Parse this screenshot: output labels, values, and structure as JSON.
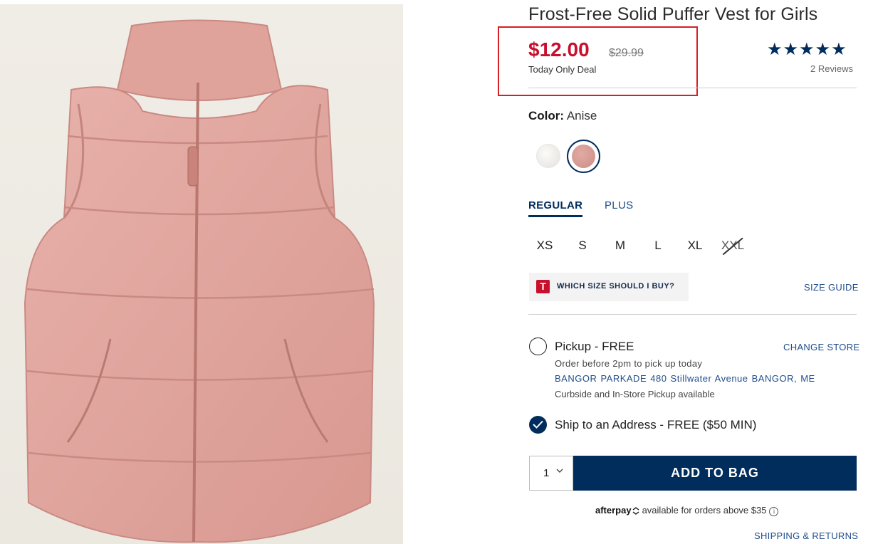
{
  "product": {
    "title": "Frost-Free Solid Puffer Vest for Girls",
    "image_alt": "pink puffer vest product photo"
  },
  "price": {
    "current": "$12.00",
    "original": "$29.99",
    "deal_label": "Today Only Deal",
    "highlight_color": "#d81f26"
  },
  "rating": {
    "stars": 5,
    "stars_glyph": "★★★★★",
    "reviews_label": "2 Reviews"
  },
  "color": {
    "label": "Color:",
    "selected": "Anise",
    "swatches": [
      {
        "name": "white",
        "hex": "#f2f1ee",
        "selected": false
      },
      {
        "name": "anise-pink",
        "hex": "#d49b95",
        "selected": true
      }
    ]
  },
  "fit": {
    "tabs": [
      "REGULAR",
      "PLUS"
    ],
    "active": "REGULAR"
  },
  "sizes": [
    {
      "label": "XS",
      "available": true
    },
    {
      "label": "S",
      "available": true
    },
    {
      "label": "M",
      "available": true
    },
    {
      "label": "L",
      "available": true
    },
    {
      "label": "XL",
      "available": true
    },
    {
      "label": "XXL",
      "available": false
    }
  ],
  "size_help": {
    "badge": "T",
    "which_size": "WHICH SIZE SHOULD I BUY?",
    "size_guide": "SIZE GUIDE"
  },
  "pickup": {
    "title": "Pickup - FREE",
    "change_store": "CHANGE STORE",
    "note": "Order before 2pm to pick up today",
    "address": "BANGOR PARKADE 480 Stillwater Avenue  BANGOR, ME",
    "curbside": "Curbside and In-Store Pickup available",
    "selected": false
  },
  "ship": {
    "title": "Ship to an Address - FREE ($50 MIN)",
    "selected": true
  },
  "cart": {
    "quantity": "1",
    "add_label": "ADD TO BAG"
  },
  "afterpay": {
    "logo": "afterpay",
    "text": "available for orders above $35",
    "info": "i"
  },
  "shipping_returns": "SHIPPING & RETURNS",
  "colors": {
    "brand_navy": "#002d5c",
    "sale_red": "#c8102e",
    "link_blue": "#1f4e8c"
  }
}
